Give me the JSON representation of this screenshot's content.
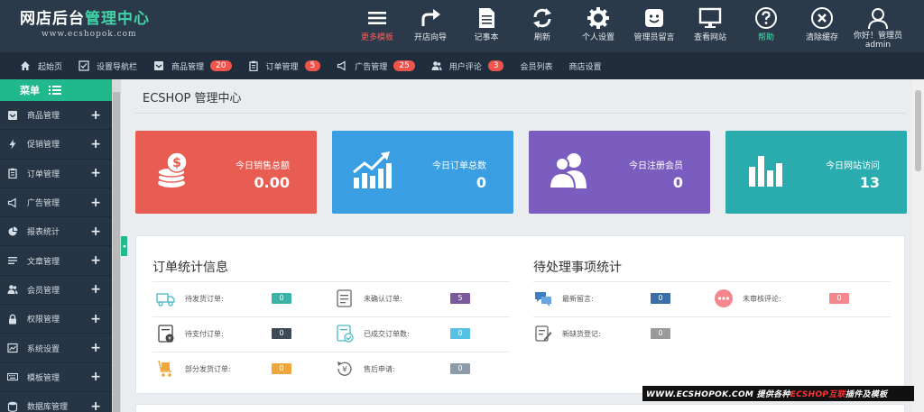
{
  "header": {
    "logo_prefix": "网店后台",
    "logo_accent": "管理中心",
    "logo_sub": "www.ecshopok.com",
    "nav": [
      {
        "label": "更多模板",
        "icon": "menu-lines-icon",
        "color": "#ff5b5b"
      },
      {
        "label": "开店向导",
        "icon": "forward-arrow-icon"
      },
      {
        "label": "记事本",
        "icon": "notepad-icon"
      },
      {
        "label": "刷新",
        "icon": "refresh-icon"
      },
      {
        "label": "个人设置",
        "icon": "gear-icon"
      },
      {
        "label": "管理员留言",
        "icon": "smiley-message-icon"
      },
      {
        "label": "查看网站",
        "icon": "monitor-icon"
      },
      {
        "label": "帮助",
        "icon": "help-circle-icon",
        "color": "#45e0b0"
      },
      {
        "label": "清除缓存",
        "icon": "close-circle-icon"
      }
    ],
    "user": {
      "greeting": "你好！管理员",
      "name": "admin",
      "icon": "user-icon"
    }
  },
  "subnav": [
    {
      "label": "起始页",
      "icon": "home-icon",
      "badge": ""
    },
    {
      "label": "设置导航栏",
      "icon": "checkbox-icon",
      "badge": ""
    },
    {
      "label": "商品管理",
      "icon": "inbox-icon",
      "badge": "20"
    },
    {
      "label": "订单管理",
      "icon": "clipboard-icon",
      "badge": "5"
    },
    {
      "label": "广告管理",
      "icon": "megaphone-icon",
      "badge": "25"
    },
    {
      "label": "用户评论",
      "icon": "users-icon",
      "badge": "3"
    },
    {
      "label": "会员列表",
      "icon": "",
      "badge": ""
    },
    {
      "label": "商店设置",
      "icon": "",
      "badge": ""
    }
  ],
  "sidebar": {
    "title": "菜单",
    "items": [
      {
        "label": "商品管理",
        "icon": "inbox-icon"
      },
      {
        "label": "促销管理",
        "icon": "lightning-icon"
      },
      {
        "label": "订单管理",
        "icon": "clipboard-icon"
      },
      {
        "label": "广告管理",
        "icon": "megaphone-icon"
      },
      {
        "label": "报表统计",
        "icon": "pie-chart-icon"
      },
      {
        "label": "文章管理",
        "icon": "list-icon"
      },
      {
        "label": "会员管理",
        "icon": "users-icon"
      },
      {
        "label": "权限管理",
        "icon": "lock-icon"
      },
      {
        "label": "系统设置",
        "icon": "chart-window-icon"
      },
      {
        "label": "模板管理",
        "icon": "keyboard-icon"
      },
      {
        "label": "数据库管理",
        "icon": "database-icon"
      }
    ]
  },
  "main": {
    "title": "ECSHOP 管理中心",
    "stats": [
      {
        "label": "今日销售总额",
        "value": "0.00",
        "color": "#e85c52",
        "icon": "coins-icon"
      },
      {
        "label": "今日订单总数",
        "value": "0",
        "color": "#3a9ee2",
        "icon": "growth-chart-icon"
      },
      {
        "label": "今日注册会员",
        "value": "0",
        "color": "#7a5dbe",
        "icon": "members-icon"
      },
      {
        "label": "今日网站访问",
        "value": "13",
        "color": "#2aabae",
        "icon": "bar-chart-icon"
      }
    ],
    "orders_panel": {
      "title": "订单统计信息",
      "rows": [
        [
          {
            "label": "待发货订单:",
            "value": "0",
            "color": "#3bb3a8",
            "icon": "truck-icon"
          },
          {
            "label": "未确认订单:",
            "value": "5",
            "color": "#7a5a9c",
            "icon": "document-lines-icon"
          }
        ],
        [
          {
            "label": "待支付订单:",
            "value": "0",
            "color": "#3e4a55",
            "icon": "payment-doc-icon"
          },
          {
            "label": "已成交订单数:",
            "value": "0",
            "color": "#56c1e3",
            "icon": "checked-doc-icon"
          }
        ],
        [
          {
            "label": "部分发货订单:",
            "value": "0",
            "color": "#f0a63a",
            "icon": "cart-box-icon"
          },
          {
            "label": "售后申请:",
            "value": "0",
            "color": "#8d9ba8",
            "icon": "refund-icon"
          }
        ]
      ]
    },
    "pending_panel": {
      "title": "待处理事项统计",
      "rows": [
        [
          {
            "label": "最新留言:",
            "value": "0",
            "color": "#3a6fa8",
            "icon": "chat-bubbles-icon"
          },
          {
            "label": "未审核评论:",
            "value": "0",
            "color": "#f4878c",
            "icon": "dots-circle-icon"
          }
        ],
        [
          {
            "label": "新缺货登记:",
            "value": "0",
            "color": "#9a9a9a",
            "icon": "edit-doc-icon"
          }
        ]
      ]
    }
  },
  "watermark": {
    "prefix": "WWW.ECSHOPOK.COM 提供各种",
    "accent": "ECSHOP互联",
    "suffix": "插件及模板"
  }
}
